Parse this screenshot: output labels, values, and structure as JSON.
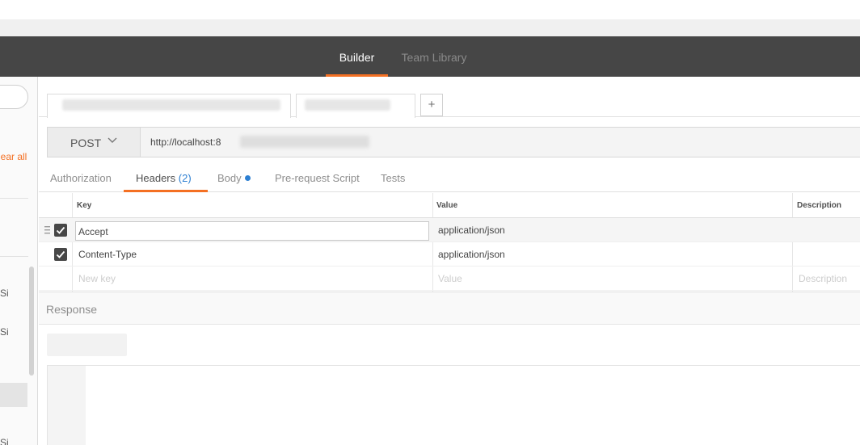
{
  "nav": {
    "builder": "Builder",
    "team_library": "Team Library"
  },
  "sidebar": {
    "clear_all": "lear all",
    "items": [
      "Si",
      "Si",
      "Si"
    ]
  },
  "request": {
    "method": "POST",
    "url": "http://localhost:8"
  },
  "subtabs": {
    "authorization": "Authorization",
    "headers": "Headers",
    "headers_count": "(2)",
    "body": "Body",
    "prerequest": "Pre-request Script",
    "tests": "Tests"
  },
  "headers_table": {
    "columns": {
      "key": "Key",
      "value": "Value",
      "description": "Description"
    },
    "rows": [
      {
        "key": "Accept",
        "value": "application/json",
        "checked": true
      },
      {
        "key": "Content-Type",
        "value": "application/json",
        "checked": true
      }
    ],
    "placeholders": {
      "key": "New key",
      "value": "Value",
      "description": "Description"
    }
  },
  "response": {
    "title": "Response"
  },
  "colors": {
    "accent": "#f47023",
    "navbar": "#464646",
    "link": "#2d7fd2"
  }
}
